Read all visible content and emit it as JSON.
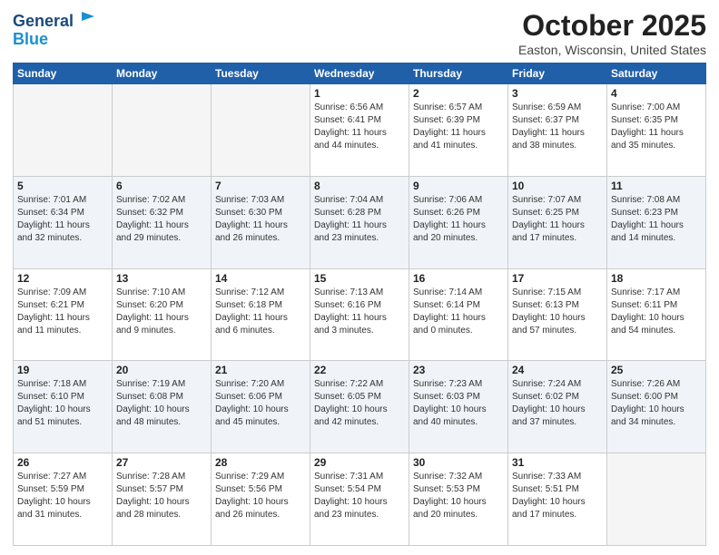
{
  "header": {
    "logo_line1": "General",
    "logo_line2": "Blue",
    "month": "October 2025",
    "location": "Easton, Wisconsin, United States"
  },
  "weekdays": [
    "Sunday",
    "Monday",
    "Tuesday",
    "Wednesday",
    "Thursday",
    "Friday",
    "Saturday"
  ],
  "weeks": [
    [
      {
        "day": "",
        "info": ""
      },
      {
        "day": "",
        "info": ""
      },
      {
        "day": "",
        "info": ""
      },
      {
        "day": "1",
        "info": "Sunrise: 6:56 AM\nSunset: 6:41 PM\nDaylight: 11 hours\nand 44 minutes."
      },
      {
        "day": "2",
        "info": "Sunrise: 6:57 AM\nSunset: 6:39 PM\nDaylight: 11 hours\nand 41 minutes."
      },
      {
        "day": "3",
        "info": "Sunrise: 6:59 AM\nSunset: 6:37 PM\nDaylight: 11 hours\nand 38 minutes."
      },
      {
        "day": "4",
        "info": "Sunrise: 7:00 AM\nSunset: 6:35 PM\nDaylight: 11 hours\nand 35 minutes."
      }
    ],
    [
      {
        "day": "5",
        "info": "Sunrise: 7:01 AM\nSunset: 6:34 PM\nDaylight: 11 hours\nand 32 minutes."
      },
      {
        "day": "6",
        "info": "Sunrise: 7:02 AM\nSunset: 6:32 PM\nDaylight: 11 hours\nand 29 minutes."
      },
      {
        "day": "7",
        "info": "Sunrise: 7:03 AM\nSunset: 6:30 PM\nDaylight: 11 hours\nand 26 minutes."
      },
      {
        "day": "8",
        "info": "Sunrise: 7:04 AM\nSunset: 6:28 PM\nDaylight: 11 hours\nand 23 minutes."
      },
      {
        "day": "9",
        "info": "Sunrise: 7:06 AM\nSunset: 6:26 PM\nDaylight: 11 hours\nand 20 minutes."
      },
      {
        "day": "10",
        "info": "Sunrise: 7:07 AM\nSunset: 6:25 PM\nDaylight: 11 hours\nand 17 minutes."
      },
      {
        "day": "11",
        "info": "Sunrise: 7:08 AM\nSunset: 6:23 PM\nDaylight: 11 hours\nand 14 minutes."
      }
    ],
    [
      {
        "day": "12",
        "info": "Sunrise: 7:09 AM\nSunset: 6:21 PM\nDaylight: 11 hours\nand 11 minutes."
      },
      {
        "day": "13",
        "info": "Sunrise: 7:10 AM\nSunset: 6:20 PM\nDaylight: 11 hours\nand 9 minutes."
      },
      {
        "day": "14",
        "info": "Sunrise: 7:12 AM\nSunset: 6:18 PM\nDaylight: 11 hours\nand 6 minutes."
      },
      {
        "day": "15",
        "info": "Sunrise: 7:13 AM\nSunset: 6:16 PM\nDaylight: 11 hours\nand 3 minutes."
      },
      {
        "day": "16",
        "info": "Sunrise: 7:14 AM\nSunset: 6:14 PM\nDaylight: 11 hours\nand 0 minutes."
      },
      {
        "day": "17",
        "info": "Sunrise: 7:15 AM\nSunset: 6:13 PM\nDaylight: 10 hours\nand 57 minutes."
      },
      {
        "day": "18",
        "info": "Sunrise: 7:17 AM\nSunset: 6:11 PM\nDaylight: 10 hours\nand 54 minutes."
      }
    ],
    [
      {
        "day": "19",
        "info": "Sunrise: 7:18 AM\nSunset: 6:10 PM\nDaylight: 10 hours\nand 51 minutes."
      },
      {
        "day": "20",
        "info": "Sunrise: 7:19 AM\nSunset: 6:08 PM\nDaylight: 10 hours\nand 48 minutes."
      },
      {
        "day": "21",
        "info": "Sunrise: 7:20 AM\nSunset: 6:06 PM\nDaylight: 10 hours\nand 45 minutes."
      },
      {
        "day": "22",
        "info": "Sunrise: 7:22 AM\nSunset: 6:05 PM\nDaylight: 10 hours\nand 42 minutes."
      },
      {
        "day": "23",
        "info": "Sunrise: 7:23 AM\nSunset: 6:03 PM\nDaylight: 10 hours\nand 40 minutes."
      },
      {
        "day": "24",
        "info": "Sunrise: 7:24 AM\nSunset: 6:02 PM\nDaylight: 10 hours\nand 37 minutes."
      },
      {
        "day": "25",
        "info": "Sunrise: 7:26 AM\nSunset: 6:00 PM\nDaylight: 10 hours\nand 34 minutes."
      }
    ],
    [
      {
        "day": "26",
        "info": "Sunrise: 7:27 AM\nSunset: 5:59 PM\nDaylight: 10 hours\nand 31 minutes."
      },
      {
        "day": "27",
        "info": "Sunrise: 7:28 AM\nSunset: 5:57 PM\nDaylight: 10 hours\nand 28 minutes."
      },
      {
        "day": "28",
        "info": "Sunrise: 7:29 AM\nSunset: 5:56 PM\nDaylight: 10 hours\nand 26 minutes."
      },
      {
        "day": "29",
        "info": "Sunrise: 7:31 AM\nSunset: 5:54 PM\nDaylight: 10 hours\nand 23 minutes."
      },
      {
        "day": "30",
        "info": "Sunrise: 7:32 AM\nSunset: 5:53 PM\nDaylight: 10 hours\nand 20 minutes."
      },
      {
        "day": "31",
        "info": "Sunrise: 7:33 AM\nSunset: 5:51 PM\nDaylight: 10 hours\nand 17 minutes."
      },
      {
        "day": "",
        "info": ""
      }
    ]
  ]
}
